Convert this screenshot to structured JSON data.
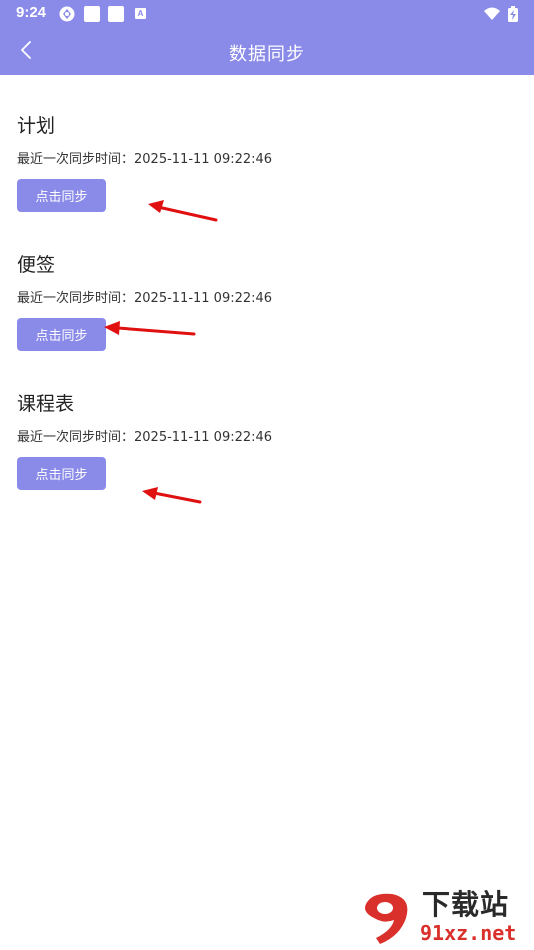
{
  "status_bar": {
    "time": "9:24",
    "icons": [
      "sync-icon",
      "notification-square-icon",
      "notification-square-icon",
      "a-icon",
      "wifi-icon",
      "battery-charging-icon"
    ],
    "a_icon_text": "A"
  },
  "header": {
    "title": "数据同步",
    "back_icon": "chevron-left-icon",
    "background_color": "#8a8ae8"
  },
  "sections": [
    {
      "title": "计划",
      "sync_time": "最近一次同步时间：2025-11-11 09:22:46",
      "button_label": "点击同步"
    },
    {
      "title": "便签",
      "sync_time": "最近一次同步时间：2025-11-11 09:22:46",
      "button_label": "点击同步"
    },
    {
      "title": "课程表",
      "sync_time": "最近一次同步时间：2025-11-11 09:22:46",
      "button_label": "点击同步"
    }
  ],
  "watermark": {
    "logo_text": "9",
    "name": "下载站",
    "url": "91xz.net"
  },
  "colors": {
    "accent": "#8a8ae8",
    "annotation_arrow": "#e01010",
    "watermark_red": "#d9302b"
  }
}
